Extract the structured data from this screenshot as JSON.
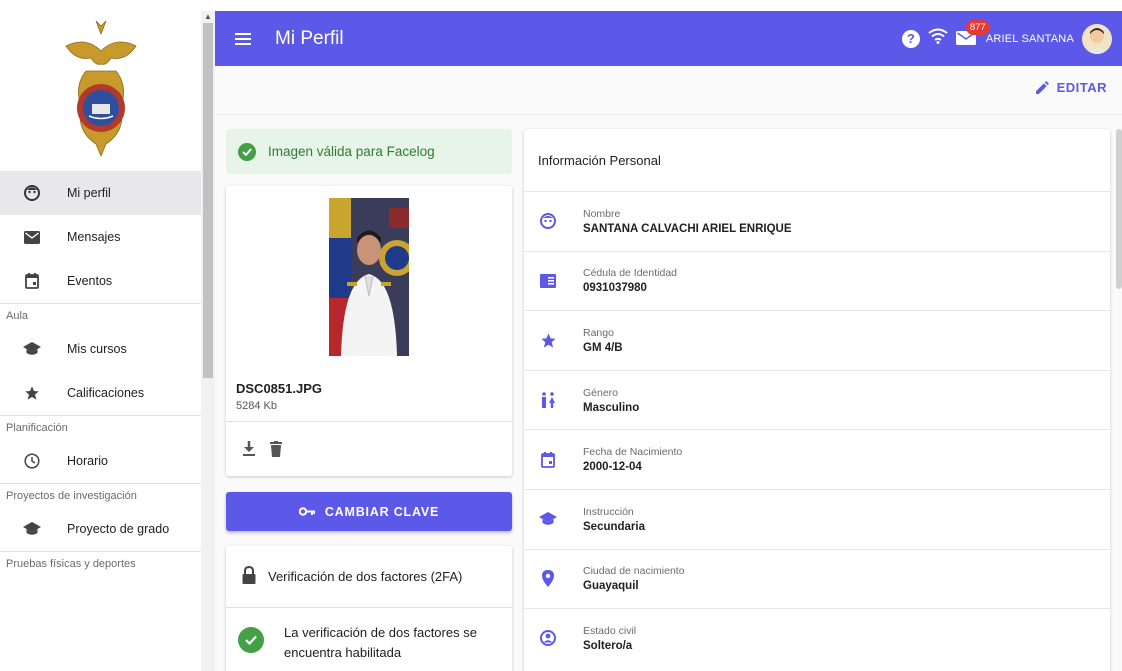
{
  "header": {
    "title": "Mi Perfil",
    "notification_count": "877",
    "user_name": "ARIEL SANTANA"
  },
  "toolbar": {
    "edit_label": "EDITAR"
  },
  "sidebar": {
    "items": [
      {
        "label": "Mi perfil",
        "icon": "face-icon",
        "active": true
      },
      {
        "label": "Mensajes",
        "icon": "mail-icon"
      },
      {
        "label": "Eventos",
        "icon": "calendar-icon"
      }
    ],
    "sections": [
      {
        "title": "Aula",
        "items": [
          {
            "label": "Mis cursos",
            "icon": "school-icon"
          },
          {
            "label": "Calificaciones",
            "icon": "star-icon"
          }
        ]
      },
      {
        "title": "Planificación",
        "items": [
          {
            "label": "Horario",
            "icon": "clock-icon"
          }
        ]
      },
      {
        "title": "Proyectos de investigación",
        "items": [
          {
            "label": "Proyecto de grado",
            "icon": "school-icon"
          }
        ]
      },
      {
        "title": "Pruebas físicas y deportes"
      }
    ]
  },
  "photo": {
    "valid_message": "Imagen válida para Facelog",
    "file_name": "DSC0851.JPG",
    "file_size": "5284 Kb"
  },
  "change_password_label": "CAMBIAR CLAVE",
  "twofa": {
    "title": "Verificación de dos factores (2FA)",
    "status_line1": "La verificación de dos factores se",
    "status_line2": "encuentra habilitada"
  },
  "personal_info": {
    "title": "Información Personal",
    "fields": [
      {
        "label": "Nombre",
        "value": "SANTANA CALVACHI ARIEL ENRIQUE",
        "icon": "face-icon"
      },
      {
        "label": "Cédula de Identidad",
        "value": "0931037980",
        "icon": "id-card-icon"
      },
      {
        "label": "Rango",
        "value": "GM 4/B",
        "icon": "star-icon"
      },
      {
        "label": "Género",
        "value": "Masculino",
        "icon": "gender-icon"
      },
      {
        "label": "Fecha de Nacimiento",
        "value": "2000-12-04",
        "icon": "calendar-icon"
      },
      {
        "label": "Instrucción",
        "value": "Secundaria",
        "icon": "school-icon"
      },
      {
        "label": "Ciudad de nacimiento",
        "value": "Guayaquil",
        "icon": "location-pin-icon"
      },
      {
        "label": "Estado civil",
        "value": "Soltero/a",
        "icon": "person-badge-icon"
      }
    ]
  },
  "colors": {
    "primary": "#5c58e8",
    "success": "#43a047",
    "badge": "#e53935"
  }
}
